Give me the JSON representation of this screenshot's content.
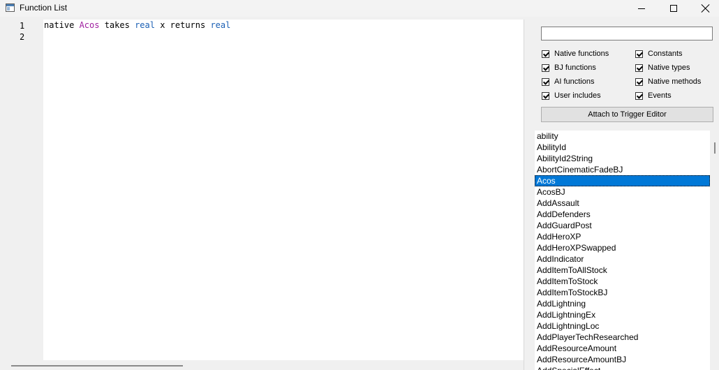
{
  "window": {
    "title": "Function List"
  },
  "editor": {
    "line_numbers": [
      "1",
      "2"
    ],
    "code_line": {
      "t1": "native ",
      "t2": "Acos",
      "t3": " takes ",
      "t4": "real",
      "t5": " x returns ",
      "t6": "real"
    }
  },
  "search": {
    "value": ""
  },
  "filters": [
    {
      "label": "Native functions",
      "checked": true
    },
    {
      "label": "BJ functions",
      "checked": true
    },
    {
      "label": "AI functions",
      "checked": true
    },
    {
      "label": "User includes",
      "checked": true
    },
    {
      "label": "Constants",
      "checked": true
    },
    {
      "label": "Native types",
      "checked": true
    },
    {
      "label": "Native methods",
      "checked": true
    },
    {
      "label": "Events",
      "checked": true
    }
  ],
  "attach_button": {
    "label": "Attach to Trigger Editor"
  },
  "functions": [
    "ability",
    "AbilityId",
    "AbilityId2String",
    "AbortCinematicFadeBJ",
    "Acos",
    "AcosBJ",
    "AddAssault",
    "AddDefenders",
    "AddGuardPost",
    "AddHeroXP",
    "AddHeroXPSwapped",
    "AddIndicator",
    "AddItemToAllStock",
    "AddItemToStock",
    "AddItemToStockBJ",
    "AddLightning",
    "AddLightningEx",
    "AddLightningLoc",
    "AddPlayerTechResearched",
    "AddResourceAmount",
    "AddResourceAmountBJ",
    "AddSpecialEffect"
  ],
  "selected_function": "Acos",
  "colors": {
    "selection": "#0078d7",
    "keyword_name": "#a020a0",
    "keyword_type": "#1a5fb4"
  }
}
